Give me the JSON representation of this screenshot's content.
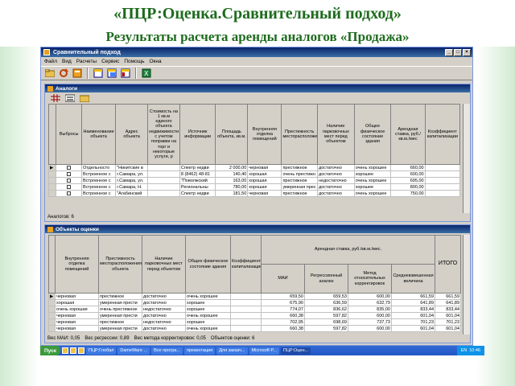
{
  "slide": {
    "title": "«ПЦР:Оценка.Сравнительный подход»",
    "subtitle": "Результаты расчета аренды аналогов «Продажа»"
  },
  "app": {
    "window_title": "Сравнительный подход",
    "menu": [
      "Файл",
      "Вид",
      "Расчеты",
      "Сервис",
      "Помощь",
      "Окна"
    ],
    "toolbar_icons": [
      "open-folder-icon",
      "refresh-icon",
      "calc-icon",
      "window-tile-icon",
      "window-cascade-icon",
      "window-arrange-icon",
      "excel-icon"
    ]
  },
  "analogs": {
    "title": "Аналоги",
    "headers": [
      "Выбросы",
      "Наименование объекта",
      "Адрес объекта",
      "Стоимость на 1 кв.м единого объекта недвижимости с учетом поправки на торг и некоторые услуги, р",
      "Источник информации",
      "Площадь объекта, кв.м.",
      "Внутренняя отделка помещений",
      "Престижность месторасположения",
      "Наличие парковочных мест перед объектом",
      "Общее физическое состояние здания",
      "Арендная ставка, руб./кв.м./мес",
      "Коэффициент капитализации"
    ],
    "rows": [
      {
        "name": "Отдельносто",
        "addr": "\"Никитские в",
        "price": "",
        "source": "Спектр недви",
        "area": "2 000,00",
        "finish": "черновая",
        "prestige": "престижное",
        "parking": "достаточно",
        "state": "очень хорошее",
        "rate": "660,00",
        "coef": ""
      },
      {
        "name": "Встроенное с",
        "addr": "г.Самара, ул.",
        "price": "",
        "source": "8 (8462) 48-81",
        "area": "140,40",
        "finish": "хорошая",
        "prestige": "очень престижн",
        "parking": "достаточно",
        "state": "хорошее",
        "rate": "600,00",
        "coef": ""
      },
      {
        "name": "Встроенное с",
        "addr": "г.Самара, ул.",
        "price": "",
        "source": "\"Поволжский",
        "area": "163,00",
        "finish": "хорошая",
        "prestige": "престижное",
        "parking": "недостаточно",
        "state": "очень хорошее",
        "rate": "695,00",
        "coef": ""
      },
      {
        "name": "Встроенное с",
        "addr": "г.Самара, Н.",
        "price": "",
        "source": "Региональны",
        "area": "780,00",
        "finish": "хорошая",
        "prestige": "умеренная прес",
        "parking": "достаточно",
        "state": "хорошее",
        "rate": "800,00",
        "coef": ""
      },
      {
        "name": "Встроенное с",
        "addr": "\"Агабинский",
        "price": "",
        "source": "Спектр недви",
        "area": "181,50",
        "finish": "черновая",
        "prestige": "престижное",
        "parking": "достаточно",
        "state": "очень хорошее",
        "rate": "750,00",
        "coef": ""
      }
    ],
    "footer": "Аналогов: 6"
  },
  "results": {
    "title": "Объекты оценки",
    "headers": {
      "finish": "Внутренняя отделка помещений",
      "prestige": "Престижность месторасположения объекта",
      "parking": "Наличие парковочных мест перед объектом",
      "state": "Общее физическое состояние здания",
      "coef": "Коэффициент капитализации",
      "rate_group": "Арендная ставка, руб./кв.м./мес.",
      "mai": "МАИ",
      "regr": "Регрессионный анализ",
      "corr": "Метод относительных корректировок",
      "avg": "Средневзвешенная величина",
      "total": "ИТОГО"
    },
    "rows": [
      {
        "finish": "черновая",
        "prestige": "престижное",
        "parking": "достаточно",
        "state": "очень хорошее",
        "coef": "",
        "mai": "659,50",
        "regr": "659,53",
        "corr": "600,00",
        "avg": "661,59",
        "total": "661,59"
      },
      {
        "finish": "хорошая",
        "prestige": "умеренная прести",
        "parking": "достаточно",
        "state": "хорошее",
        "coef": "",
        "mai": "675,90",
        "regr": "636,59",
        "corr": "632,79",
        "avg": "641,89",
        "total": "641,89"
      },
      {
        "finish": "очень хорошая",
        "prestige": "очень престижное",
        "parking": "недостаточно",
        "state": "хорошее",
        "coef": "",
        "mai": "774,07",
        "regr": "836,62",
        "corr": "835,00",
        "avg": "833,44",
        "total": "833,44"
      },
      {
        "finish": "черновая",
        "prestige": "умеренная прести",
        "parking": "достаточно",
        "state": "очень хорошее",
        "coef": "",
        "mai": "660,38",
        "regr": "597,82",
        "corr": "600,00",
        "avg": "601,04",
        "total": "601,04"
      },
      {
        "finish": "черновая",
        "prestige": "престижное",
        "parking": "недостаточно",
        "state": "хорошее",
        "coef": "",
        "mai": "702,95",
        "regr": "698,69",
        "corr": "737,73",
        "avg": "701,23",
        "total": "701,23"
      },
      {
        "finish": "черновая",
        "prestige": "умеренная прести",
        "parking": "достаточно",
        "state": "очень хорошее",
        "coef": "",
        "mai": "660,38",
        "regr": "597,82",
        "corr": "600,00",
        "avg": "601,04",
        "total": "601,04"
      }
    ],
    "status": [
      "Вес МАИ: 0,05",
      "Вес регрессии: 0,89",
      "Вес метода корректировок: 0,05",
      "Объектов оценки: 6"
    ]
  },
  "taskbar": {
    "start": "Пуск",
    "buttons": [
      "ПЦР:Глобал",
      "DameWare ...",
      "Все програ...",
      "презентация",
      "Для заказч...",
      "Microsoft P...",
      "ПЦР:Оцен..."
    ],
    "lang": "EN",
    "clock": "10:46"
  }
}
